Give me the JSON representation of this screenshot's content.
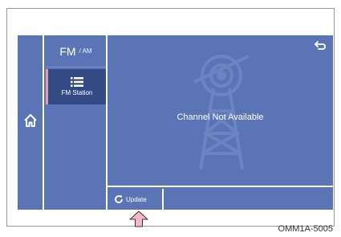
{
  "band": {
    "main": "FM",
    "sub": "/ AM"
  },
  "station": {
    "label": "FM Station"
  },
  "main": {
    "message": "Channel Not Available"
  },
  "update": {
    "label": "Update"
  },
  "figure_code": "OMM1A-5005",
  "icons": {
    "home": "home-icon",
    "station_list": "list-icon",
    "back": "back-arrow-icon",
    "refresh": "refresh-icon",
    "tower": "broadcast-tower-icon",
    "pointer": "up-arrow-callout-icon"
  },
  "colors": {
    "screen_bg": "#5b74b6",
    "selected_bg": "#334a85",
    "selected_marker": "#e59aaa",
    "callout_arrow": "#f4b6c8"
  }
}
